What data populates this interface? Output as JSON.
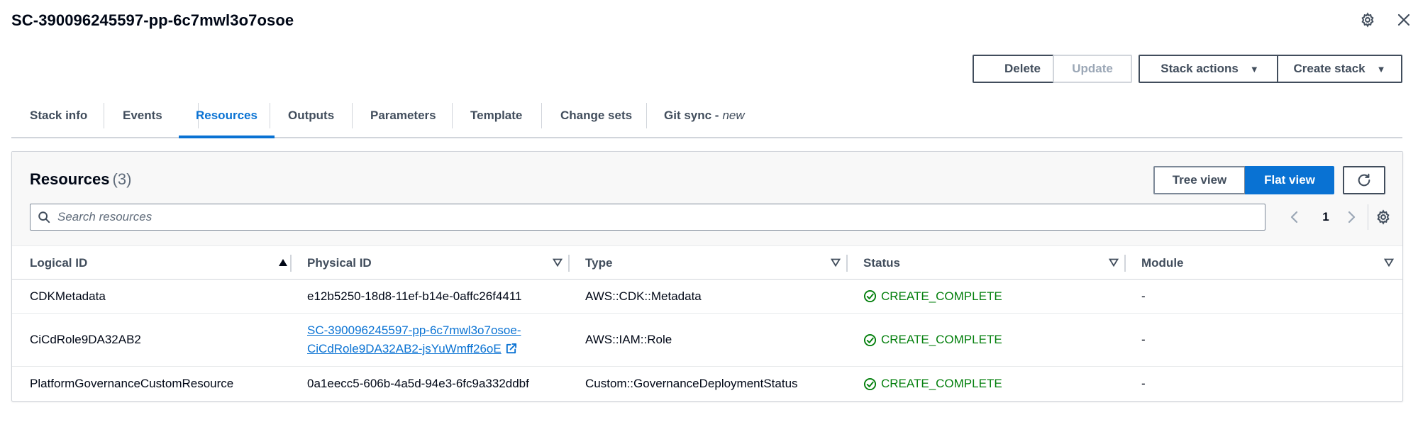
{
  "page": {
    "title": "SC-390096245597-pp-6c7mwl3o7osoe"
  },
  "icons": {
    "settings": "gear-icon",
    "close": "close-icon",
    "search": "search-icon",
    "refresh": "refresh-icon",
    "external": "external-link-icon",
    "status_ok": "status-success-icon"
  },
  "colors": {
    "accent": "#0972d3",
    "success": "#037f0c",
    "text": "#000716",
    "muted": "#414d5c"
  },
  "actions": {
    "delete": "Delete",
    "update": "Update",
    "stack_actions": "Stack actions",
    "create_stack": "Create stack"
  },
  "tabs": [
    {
      "label": "Stack info"
    },
    {
      "label": "Events"
    },
    {
      "label": "Resources",
      "active": true
    },
    {
      "label": "Outputs"
    },
    {
      "label": "Parameters"
    },
    {
      "label": "Template"
    },
    {
      "label": "Change sets"
    },
    {
      "label": "Git sync -",
      "badge": "new"
    }
  ],
  "resources": {
    "title": "Resources",
    "count": "(3)",
    "tree_view": "Tree view",
    "flat_view": "Flat view",
    "search_placeholder": "Search resources",
    "page": "1",
    "columns": [
      "Logical ID",
      "Physical ID",
      "Type",
      "Status",
      "Module"
    ],
    "rows": [
      {
        "logical_id": "CDKMetadata",
        "physical_id": "e12b5250-18d8-11ef-b14e-0affc26f4411",
        "type": "AWS::CDK::Metadata",
        "status": "CREATE_COMPLETE",
        "module": "-"
      },
      {
        "logical_id": "CiCdRole9DA32AB2",
        "physical_id_line1": "SC-390096245597-pp-6c7mwl3o7osoe-",
        "physical_id_line2": "CiCdRole9DA32AB2-jsYuWmff26oE",
        "type": "AWS::IAM::Role",
        "status": "CREATE_COMPLETE",
        "module": "-"
      },
      {
        "logical_id": "PlatformGovernanceCustomResource",
        "physical_id": "0a1eecc5-606b-4a5d-94e3-6fc9a332ddbf",
        "type": "Custom::GovernanceDeploymentStatus",
        "status": "CREATE_COMPLETE",
        "module": "-"
      }
    ]
  }
}
